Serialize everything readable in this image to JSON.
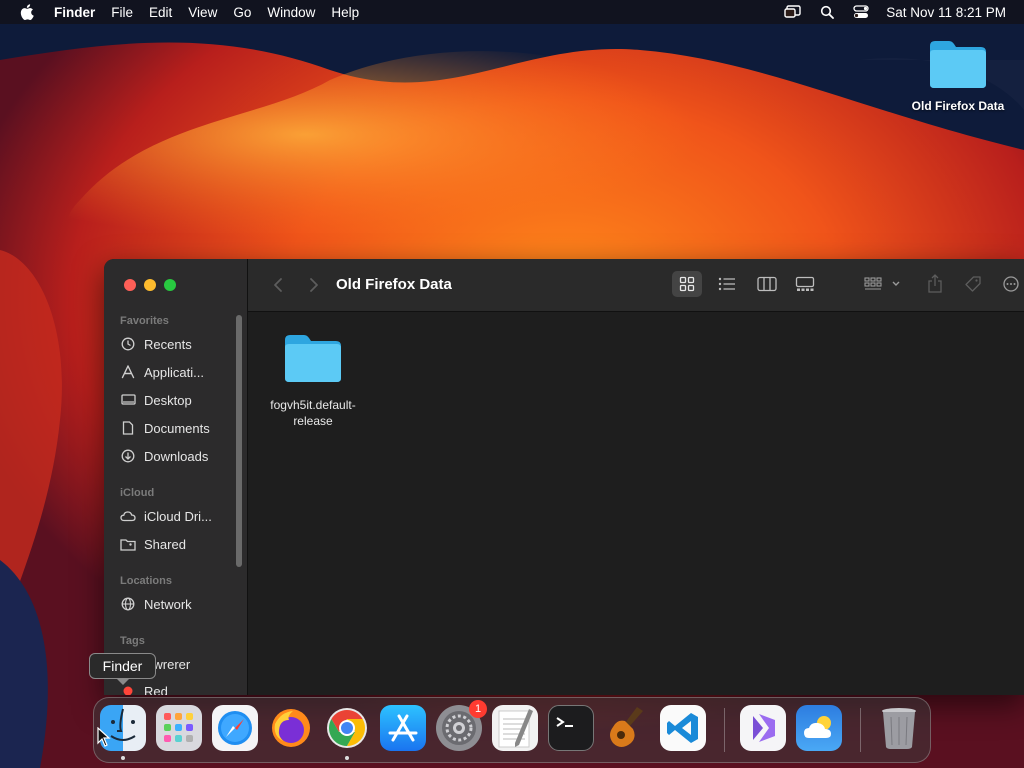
{
  "menubar": {
    "app_name": "Finder",
    "menus": [
      "File",
      "Edit",
      "View",
      "Go",
      "Window",
      "Help"
    ],
    "clock": "Sat Nov 11  8:21 PM"
  },
  "desktop": {
    "folder_label": "Old Firefox Data"
  },
  "finder": {
    "title": "Old Firefox Data",
    "sidebar": {
      "favorites_header": "Favorites",
      "favorites": [
        "Recents",
        "Applicati...",
        "Desktop",
        "Documents",
        "Downloads"
      ],
      "icloud_header": "iCloud",
      "icloud": [
        "iCloud Dri...",
        "Shared"
      ],
      "locations_header": "Locations",
      "locations": [
        "Network"
      ],
      "tags_header": "Tags",
      "tags": [
        "wwrerer",
        "Red"
      ]
    },
    "content": {
      "items": [
        {
          "name": "fogvh5it.default-release"
        }
      ]
    }
  },
  "tooltip": {
    "text": "Finder"
  },
  "dock": {
    "apps": [
      {
        "name": "Finder",
        "icon": "finder-icon",
        "running": true
      },
      {
        "name": "Launchpad",
        "icon": "launchpad-icon",
        "running": false
      },
      {
        "name": "Safari",
        "icon": "safari-icon",
        "running": false
      },
      {
        "name": "Firefox",
        "icon": "firefox-icon",
        "running": false
      },
      {
        "name": "Chrome",
        "icon": "chrome-icon",
        "running": true
      },
      {
        "name": "App Store",
        "icon": "app-store-icon",
        "running": false
      },
      {
        "name": "System Settings",
        "icon": "settings-icon",
        "running": false,
        "badge": "1"
      },
      {
        "name": "TextEdit",
        "icon": "textedit-icon",
        "running": false
      },
      {
        "name": "Terminal",
        "icon": "terminal-icon",
        "running": false
      },
      {
        "name": "GarageBand",
        "icon": "guitar-icon",
        "running": false
      },
      {
        "name": "VS Code",
        "icon": "vscode-icon",
        "running": false
      },
      {
        "name": "Visual Studio",
        "icon": "visual-studio-icon",
        "running": false
      },
      {
        "name": "Weather",
        "icon": "weather-icon",
        "running": false
      },
      {
        "name": "Trash",
        "icon": "trash-icon",
        "running": false
      }
    ]
  },
  "colors": {
    "close": "#fe5f57",
    "minimize": "#febc2e",
    "maximize": "#28c840",
    "folder": "#4fc3f7"
  }
}
